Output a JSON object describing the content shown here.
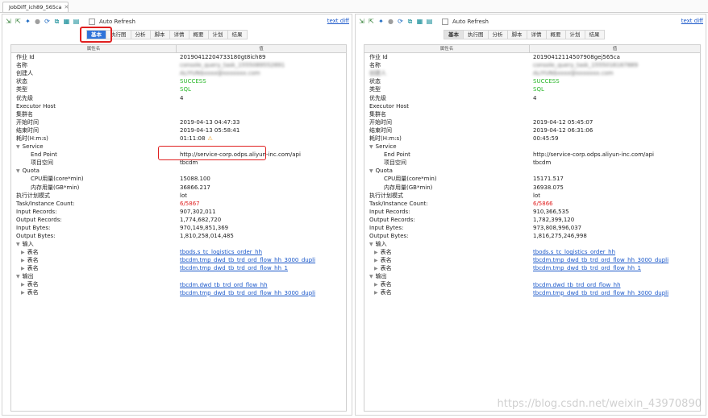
{
  "window": {
    "file_tab": "JobDiff_ich89_565ca"
  },
  "toolbar": {
    "auto_refresh": "Auto Refresh",
    "text_diff": "text diff"
  },
  "subtabs": [
    "基本",
    "执行图",
    "分析",
    "脚本",
    "详情",
    "概要",
    "计划",
    "结果"
  ],
  "grid_header": {
    "name": "属性名",
    "value": "值"
  },
  "left": {
    "rows": [
      {
        "name": "作业 Id",
        "value": "20190412204733180gt8ich89"
      },
      {
        "name": "名称",
        "value": "console_query_task_1555089552891"
      },
      {
        "name": "创建人",
        "value": "ALIYUN$xxxx@xxxxxxx.com"
      },
      {
        "name": "状态",
        "value": "SUCCESS"
      },
      {
        "name": "类型",
        "value": "SQL"
      },
      {
        "name": "优先级",
        "value": "4"
      },
      {
        "name": "Executor Host",
        "value": ""
      },
      {
        "name": "集群名",
        "value": ""
      },
      {
        "name": "开始时间",
        "value": "2019-04-13 04:47:33"
      },
      {
        "name": "结束时间",
        "value": "2019-04-13 05:58:41"
      },
      {
        "name": "耗时(H:m:s)",
        "value": "01:11:08"
      },
      {
        "name": "Service",
        "value": ""
      },
      {
        "name": "End Point",
        "value": "http://service-corp.odps.aliyun-inc.com/api"
      },
      {
        "name": "项目空间",
        "value": "tbcdm"
      },
      {
        "name": "Quota",
        "value": ""
      },
      {
        "name": "CPU用量(core*min)",
        "value": "15088.100"
      },
      {
        "name": "内存用量(GB*min)",
        "value": "36866.217"
      },
      {
        "name": "执行计划模式",
        "value": "lot"
      },
      {
        "name": "Task/Instance Count:",
        "value": "6/5867"
      },
      {
        "name": "Input Records:",
        "value": "907,302,011"
      },
      {
        "name": "Output Records:",
        "value": "1,774,682,720"
      },
      {
        "name": "Input Bytes:",
        "value": "970,149,851,369"
      },
      {
        "name": "Output Bytes:",
        "value": "1,810,258,014,485"
      },
      {
        "name": "输入",
        "value": ""
      },
      {
        "name": "表名",
        "value": "tbods.s_tc_logistics_order_hh"
      },
      {
        "name": "表名",
        "value": "tbcdm.tmp_dwd_tb_trd_ord_flow_hh_3000_dupli"
      },
      {
        "name": "表名",
        "value": "tbcdm.tmp_dwd_tb_trd_ord_flow_hh_1"
      },
      {
        "name": "输出",
        "value": ""
      },
      {
        "name": "表名",
        "value": "tbcdm.dwd_tb_trd_ord_flow_hh"
      },
      {
        "name": "表名",
        "value": "tbcdm.tmp_dwd_tb_trd_ord_flow_hh_3000_dupli"
      }
    ]
  },
  "right": {
    "rows": [
      {
        "name": "作业 Id",
        "value": "20190412114507908gej565ca"
      },
      {
        "name": "名称",
        "value": "console_query_task_1555016167889"
      },
      {
        "name": "创建人",
        "value": "ALIYUN$xxxx@xxxxxxx.com"
      },
      {
        "name": "状态",
        "value": "SUCCESS"
      },
      {
        "name": "类型",
        "value": "SQL"
      },
      {
        "name": "优先级",
        "value": "4"
      },
      {
        "name": "Executor Host",
        "value": ""
      },
      {
        "name": "集群名",
        "value": ""
      },
      {
        "name": "开始时间",
        "value": "2019-04-12 05:45:07"
      },
      {
        "name": "结束时间",
        "value": "2019-04-12 06:31:06"
      },
      {
        "name": "耗时(H:m:s)",
        "value": "00:45:59"
      },
      {
        "name": "Service",
        "value": ""
      },
      {
        "name": "End Point",
        "value": "http://service-corp.odps.aliyun-inc.com/api"
      },
      {
        "name": "项目空间",
        "value": "tbcdm"
      },
      {
        "name": "Quota",
        "value": ""
      },
      {
        "name": "CPU用量(core*min)",
        "value": "15171.517"
      },
      {
        "name": "内存用量(GB*min)",
        "value": "36938.075"
      },
      {
        "name": "执行计划模式",
        "value": "lot"
      },
      {
        "name": "Task/Instance Count:",
        "value": "6/5866"
      },
      {
        "name": "Input Records:",
        "value": "910,366,535"
      },
      {
        "name": "Output Records:",
        "value": "1,782,399,120"
      },
      {
        "name": "Input Bytes:",
        "value": "973,808,996,037"
      },
      {
        "name": "Output Bytes:",
        "value": "1,816,275,246,998"
      },
      {
        "name": "输入",
        "value": ""
      },
      {
        "name": "表名",
        "value": "tbods.s_tc_logistics_order_hh"
      },
      {
        "name": "表名",
        "value": "tbcdm.tmp_dwd_tb_trd_ord_flow_hh_3000_dupli"
      },
      {
        "name": "表名",
        "value": "tbcdm.tmp_dwd_tb_trd_ord_flow_hh_1"
      },
      {
        "name": "输出",
        "value": ""
      },
      {
        "name": "表名",
        "value": "tbcdm.dwd_tb_trd_ord_flow_hh"
      },
      {
        "name": "表名",
        "value": "tbcdm.tmp_dwd_tb_trd_ord_flow_hh_3000_dupli"
      }
    ]
  },
  "watermark": "https://blog.csdn.net/weixin_43970890",
  "colors": {
    "success": "#2eb82e",
    "error_count": "#e02020",
    "link": "#1a57c9",
    "highlight": "#e02020",
    "active_tab": "#2f73d9"
  }
}
